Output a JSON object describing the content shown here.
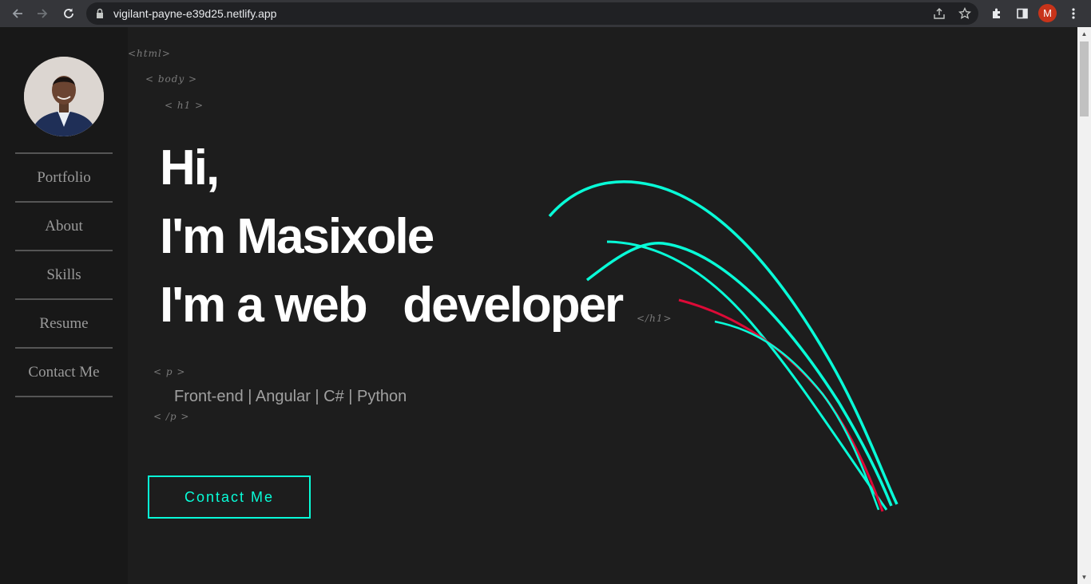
{
  "browser": {
    "url": "vigilant-payne-e39d25.netlify.app",
    "profile_initial": "M",
    "accent_profile": "#c8341a"
  },
  "sidebar": {
    "items": [
      {
        "label": "Portfolio"
      },
      {
        "label": "About"
      },
      {
        "label": "Skills"
      },
      {
        "label": "Resume"
      },
      {
        "label": "Contact Me"
      }
    ]
  },
  "hero": {
    "tag_html": "<html>",
    "tag_body": "< body >",
    "tag_h1_open": "< h1 >",
    "tag_h1_close": "</h1>",
    "tag_p_open": "< p >",
    "tag_p_close": "< /p >",
    "line1": "Hi,",
    "line2": "I'm Masixole",
    "line3": "I'm a web   developer",
    "subtitle": "Front-end | Angular | C# | Python",
    "cta_label": "Contact Me",
    "accent": "#08fdd8",
    "accent_secondary": "#dd0a37"
  }
}
